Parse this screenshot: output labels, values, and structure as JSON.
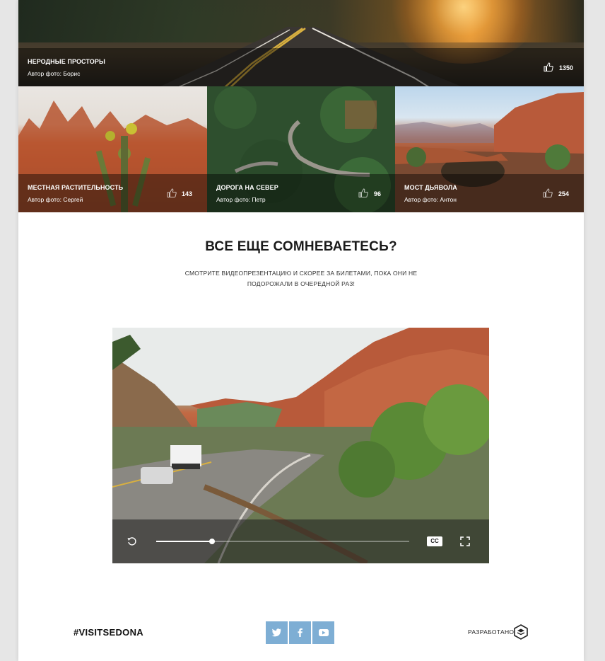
{
  "hero": {
    "title": "НЕРОДНЫЕ ПРОСТОРЫ",
    "author": "Автор фото: Борис",
    "likes": "1350",
    "icon": "thumbs-up-icon"
  },
  "tiles": [
    {
      "title": "МЕСТНАЯ РАСТИТЕЛЬНОСТЬ",
      "author": "Автор фото: Сергей",
      "likes": "143"
    },
    {
      "title": "ДОРОГА НА СЕВЕР",
      "author": "Автор фото: Петр",
      "likes": "96"
    },
    {
      "title": "МОСТ ДЬЯВОЛА",
      "author": "Автор фото: Антон",
      "likes": "254"
    }
  ],
  "section": {
    "headline": "ВСЕ ЕЩЕ СОМНЕВАЕТЕСЬ?",
    "subtext": "СМОТРИТЕ ВИДЕОПРЕЗЕНТАЦИЮ И СКОРЕЕ ЗА БИЛЕТАМИ, ПОКА ОНИ НЕ ПОДОРОЖАЛИ В ОЧЕРЕДНОЙ РАЗ!"
  },
  "video": {
    "progress": 0.22,
    "cc_label": "CC",
    "icons": [
      "replay-icon",
      "closed-captions-icon",
      "fullscreen-icon"
    ]
  },
  "footer": {
    "hashtag": "#VISITSEDONA",
    "socials": [
      "twitter-icon",
      "facebook-icon",
      "youtube-icon"
    ],
    "made_by": "РАЗРАБОТАНО",
    "colors": {
      "social_bg": "#7eaed4"
    }
  }
}
